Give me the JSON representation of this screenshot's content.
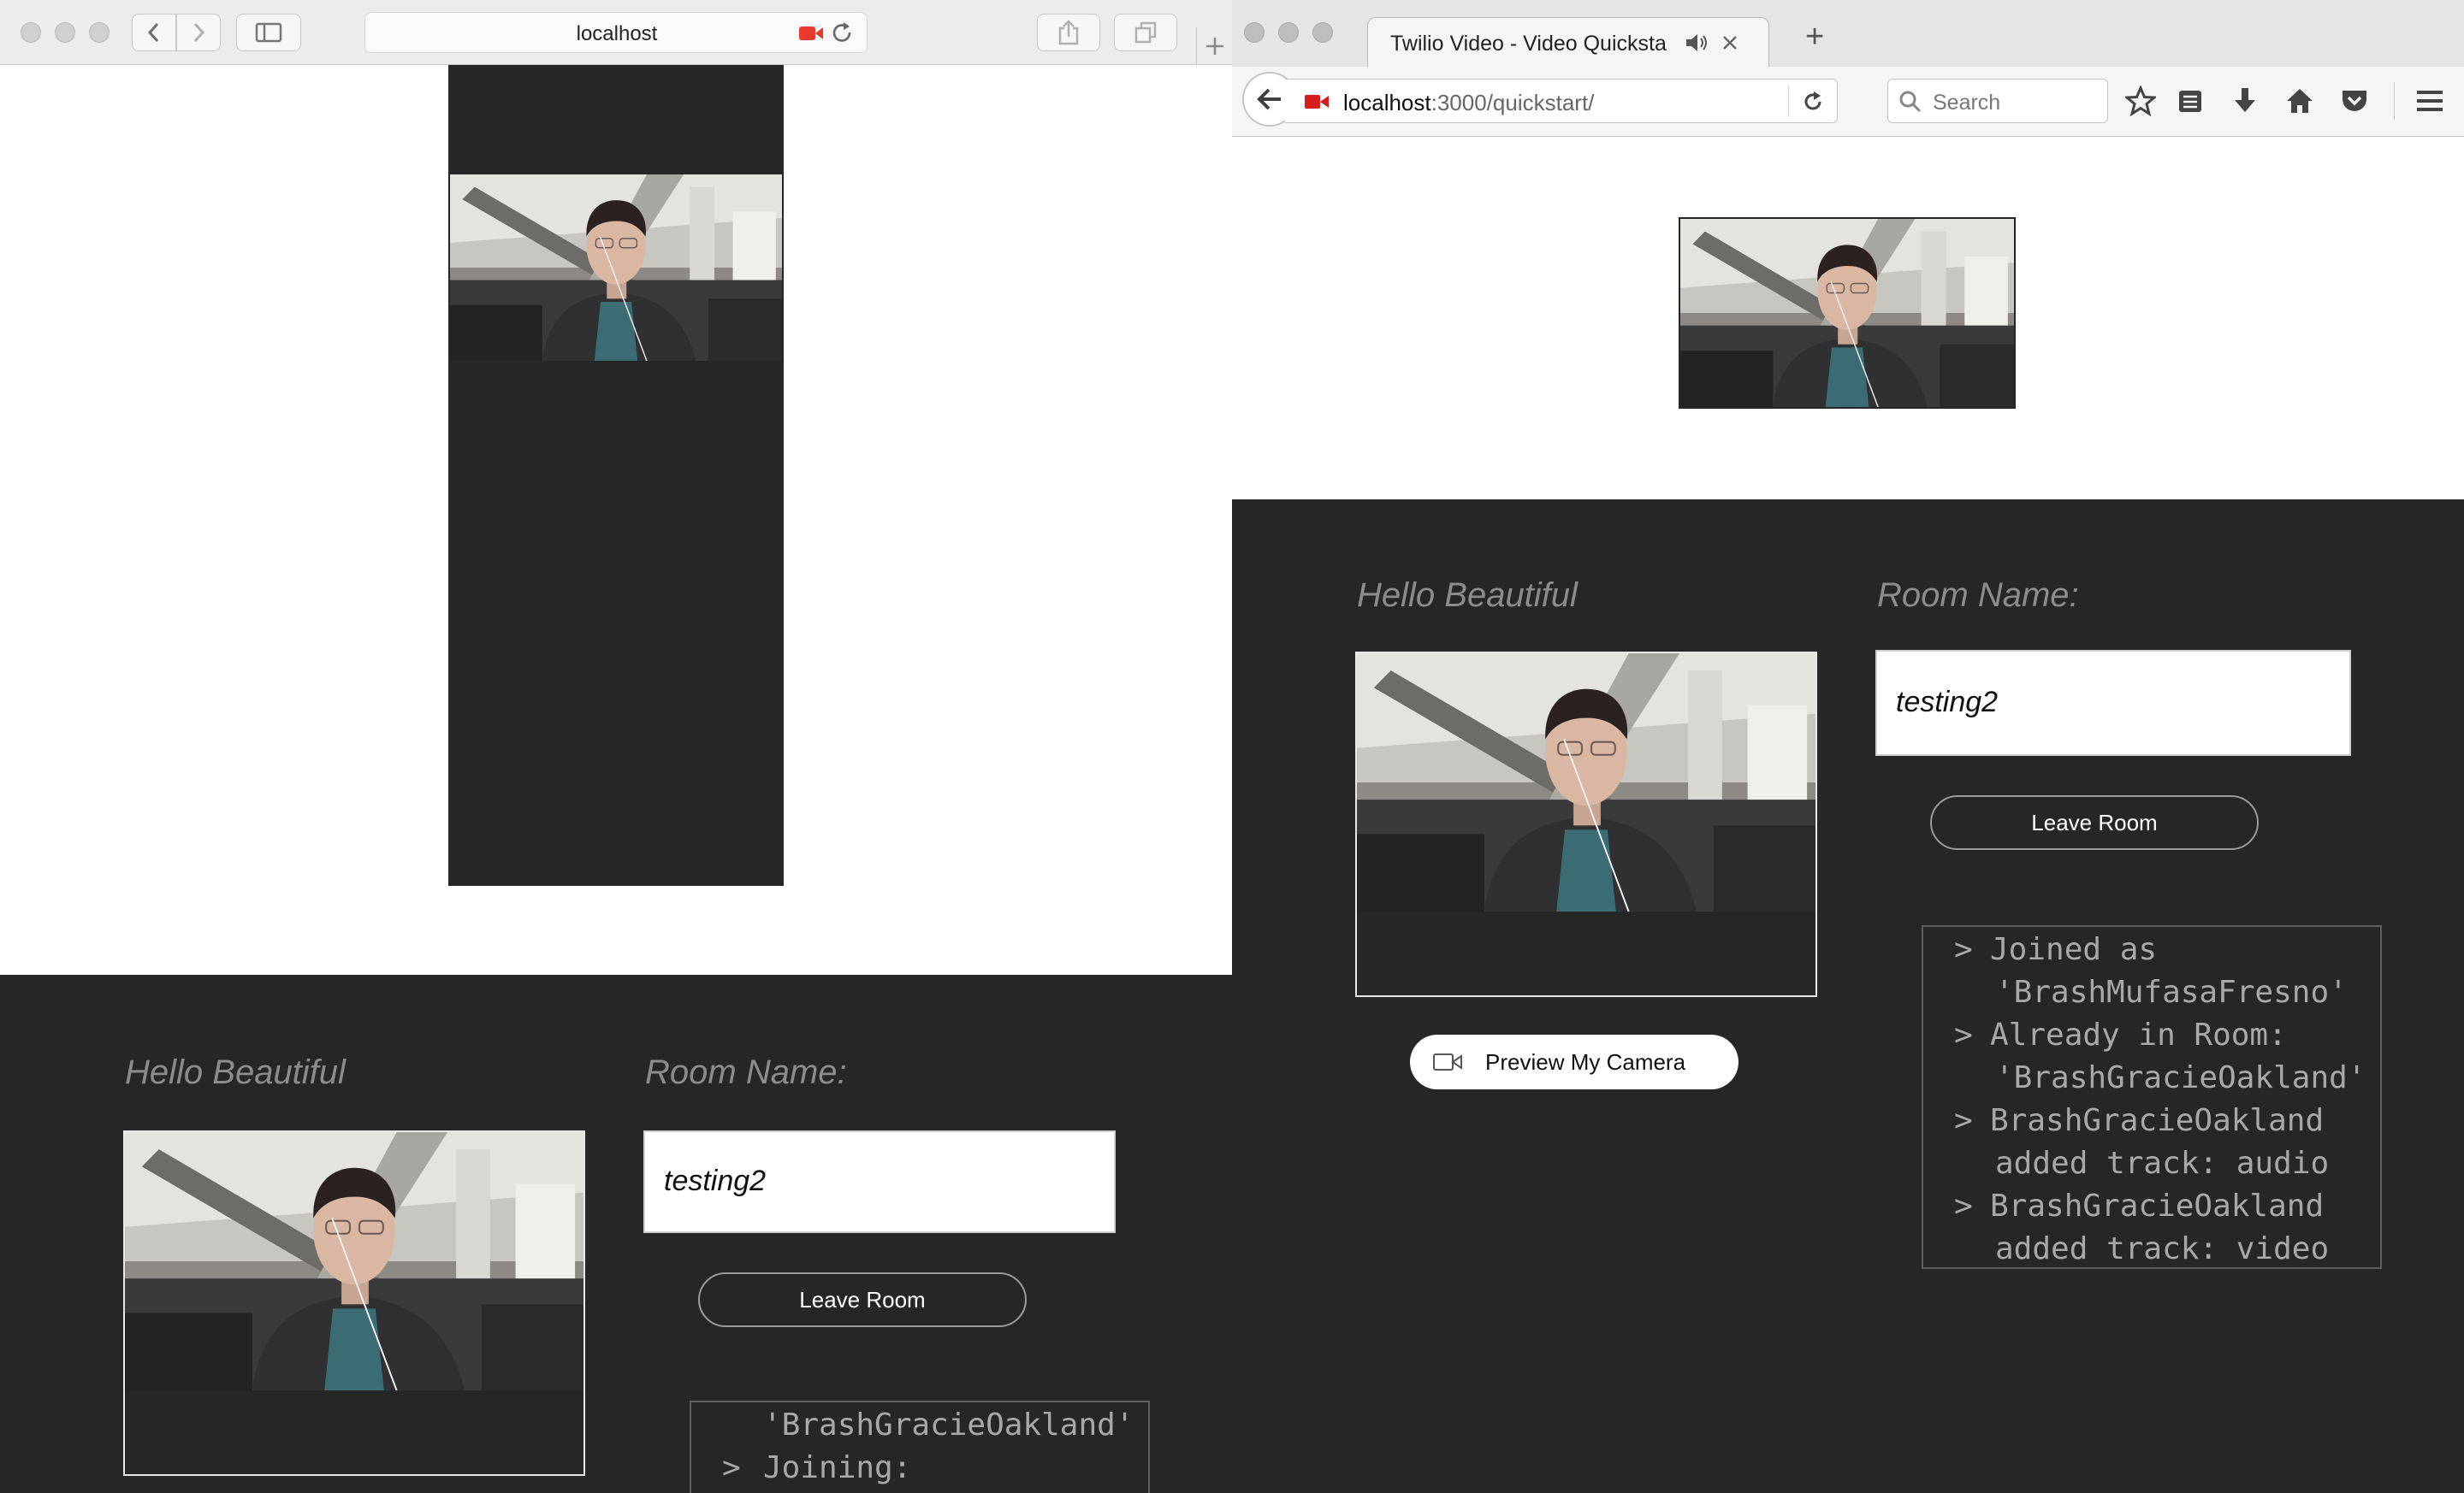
{
  "safari": {
    "address": "localhost",
    "hello": "Hello Beautiful",
    "room_label": "Room Name:",
    "room_value": "testing2",
    "leave_button": "Leave Room",
    "log": [
      {
        "prefix": "",
        "text": "'BrashGracieOakland'"
      },
      {
        "prefix": ">",
        "text": "Joining:"
      }
    ]
  },
  "firefox": {
    "tab_title": "Twilio Video - Video Quicksta",
    "new_tab": "+",
    "url_host": "localhost",
    "url_path": ":3000/quickstart/",
    "search_placeholder": "Search",
    "hello": "Hello Beautiful",
    "room_label": "Room Name:",
    "room_value": "testing2",
    "leave_button": "Leave Room",
    "preview_button": "Preview My Camera",
    "log": [
      {
        "prefix": ">",
        "text": "Joined as"
      },
      {
        "prefix": "",
        "text": "'BrashMufasaFresno'"
      },
      {
        "prefix": ">",
        "text": "Already in Room:"
      },
      {
        "prefix": "",
        "text": "'BrashGracieOakland'"
      },
      {
        "prefix": ">",
        "text": "BrashGracieOakland"
      },
      {
        "prefix": "",
        "text": "added track: audio"
      },
      {
        "prefix": ">",
        "text": "BrashGracieOakland"
      },
      {
        "prefix": "",
        "text": "added track: video"
      }
    ]
  },
  "colors": {
    "dark_bg": "#262626",
    "record_red": "#e8392f",
    "ff_red": "#d81b1b"
  },
  "icons": [
    "back-icon",
    "forward-icon",
    "sidebar-icon",
    "camera-recording-icon",
    "reload-icon",
    "share-icon",
    "tabs-icon",
    "new-tab-icon",
    "speaker-icon",
    "close-icon",
    "search-icon",
    "star-icon",
    "reading-list-icon",
    "download-icon",
    "home-icon",
    "pocket-icon",
    "menu-icon",
    "video-camera-icon"
  ]
}
